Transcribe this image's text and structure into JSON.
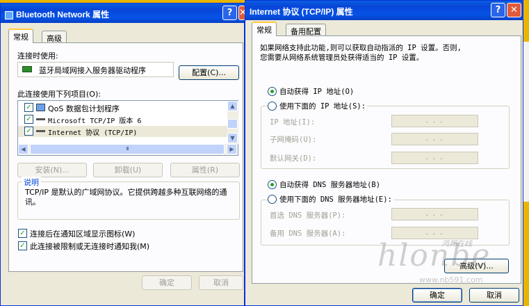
{
  "left_window": {
    "title": "Bluetooth Network 属性",
    "tabs": [
      "常规",
      "高级"
    ],
    "connect_using_label": "连接时使用:",
    "adapter_name": "蓝牙局域网接入服务器驱动程序",
    "configure_button": "配置(C)...",
    "items_label": "此连接使用下列项目(O):",
    "items": [
      "QoS 数据包计划程序",
      "Microsoft TCP/IP 版本 6",
      "Internet 协议 (TCP/IP)"
    ],
    "scroll_grip": "III",
    "install_button": "安装(N)...",
    "uninstall_button": "卸载(U)",
    "properties_button": "属性(R)",
    "description_label": "说明",
    "description_text": "TCP/IP 是默认的广域网协议。它提供跨越多种互联网络的通讯。",
    "checkbox_show_icon": "连接后在通知区域显示图标(W)",
    "checkbox_notify": "此连接被限制或无连接时通知我(M)",
    "ok_button": "确定",
    "cancel_button": "取消"
  },
  "right_window": {
    "title": "Internet 协议 (TCP/IP) 属性",
    "tabs": [
      "常规",
      "备用配置"
    ],
    "intro_line1": "如果网络支持此功能,则可以获取自动指派的 IP 设置。否则,",
    "intro_line2": "您需要从网络系统管理员处获得适当的 IP 设置。",
    "auto_ip": "自动获得 IP 地址(O)",
    "manual_ip": "使用下面的 IP 地址(S):",
    "ip_address": "IP 地址(I):",
    "subnet_mask": "子网掩码(U):",
    "default_gateway": "默认网关(D):",
    "auto_dns": "自动获得 DNS 服务器地址(B)",
    "manual_dns": "使用下面的 DNS 服务器地址(E):",
    "preferred_dns": "首选 DNS 服务器(P):",
    "alternate_dns": "备用 DNS 服务器(A):",
    "ip_placeholder": ".   .   .",
    "advanced_button": "高级(V)...",
    "ok_button": "确定",
    "cancel_button": "取消"
  },
  "title_buttons": {
    "help": "?",
    "close": "✕"
  },
  "checks": {
    "mark": "✓"
  },
  "scroll": {
    "up": "▲",
    "down": "▼",
    "left": "◀",
    "right": "▶"
  },
  "watermark": {
    "text": "hlonbe",
    "script": "鸿邦在线",
    "url": "www.nb591.com"
  },
  "selected_ip_mode": "auto",
  "selected_dns_mode": "auto"
}
